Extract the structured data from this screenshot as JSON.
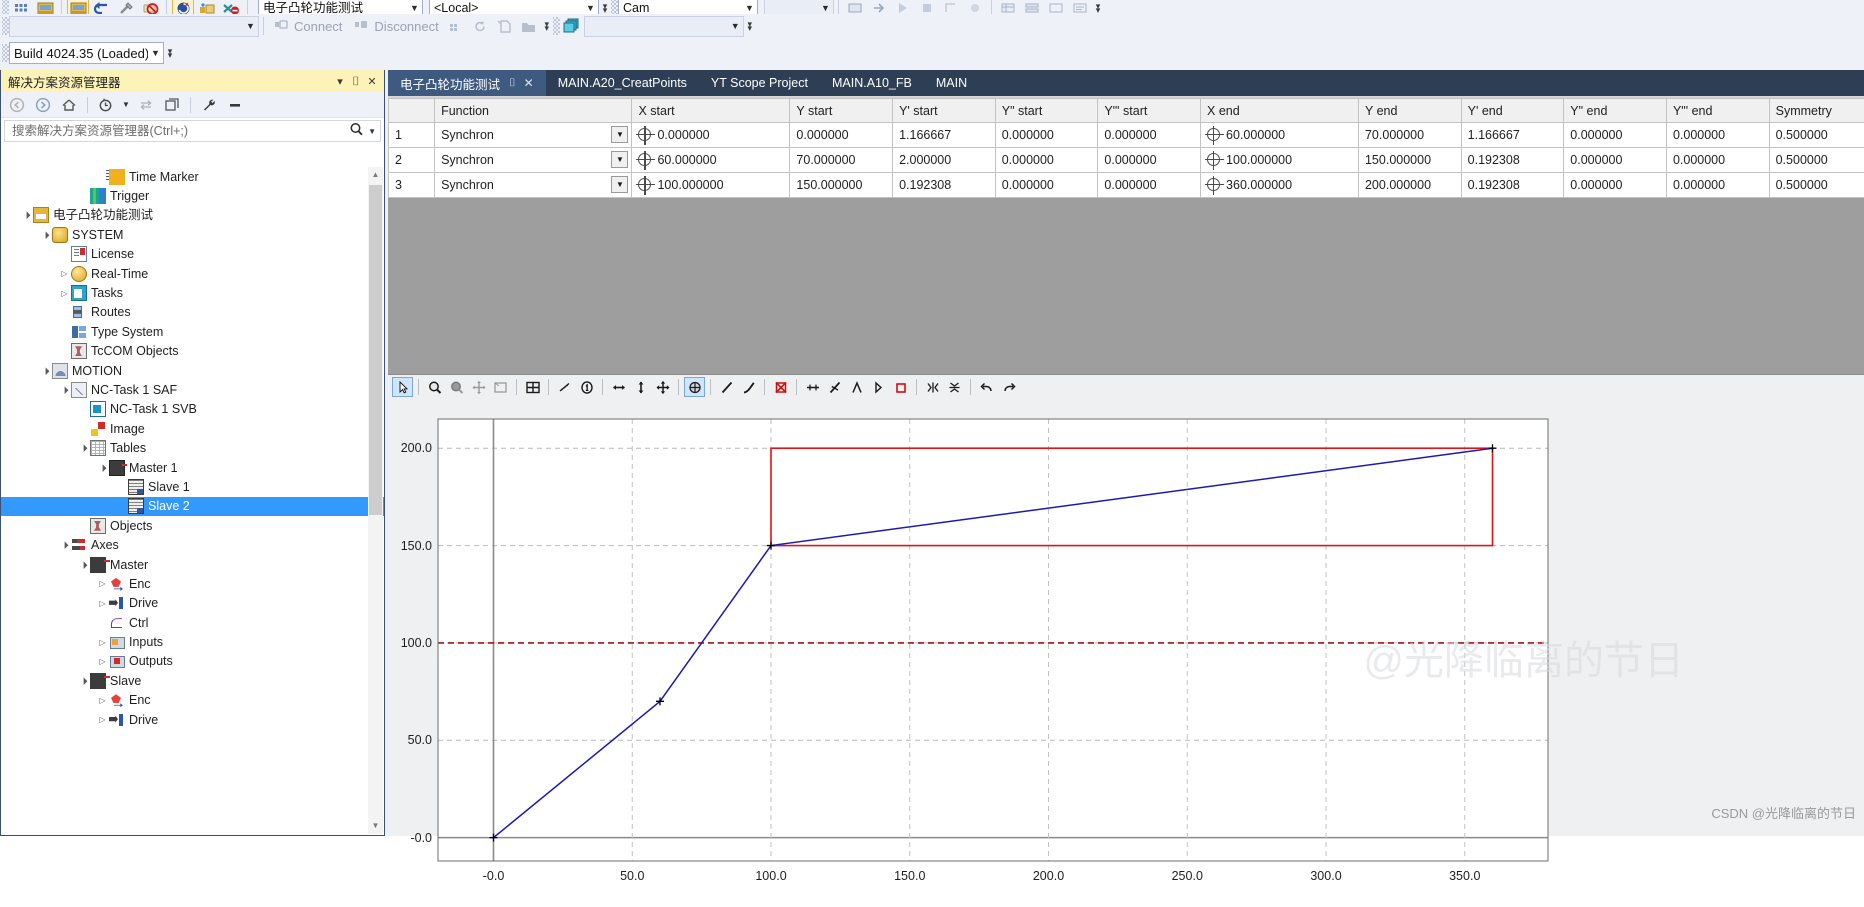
{
  "toolbar": {
    "project_combo": "电子凸轮功能测试",
    "target_combo": "<Local>",
    "cam_combo": "Cam",
    "blank_combo": "",
    "blank_combo2": "",
    "build_combo": "Build 4024.35 (Loaded)",
    "connect_label": "Connect",
    "disconnect_label": "Disconnect",
    "overflow_glyph": "▾"
  },
  "solution_explorer": {
    "title": "解决方案资源管理器",
    "title_buttons": [
      "▾",
      "⌷",
      "✕"
    ],
    "tools": [
      "back-arrow",
      "forward-arrow",
      "home",
      "history",
      "sync",
      "collapse-all",
      "properties",
      "show-all"
    ],
    "search_placeholder": "搜索解决方案资源管理器(Ctrl+;)",
    "tree": [
      {
        "label": "Time Marker",
        "indent": 5,
        "expander": "",
        "icon": "time-marker-icon",
        "selected": false
      },
      {
        "label": "Trigger",
        "indent": 4,
        "expander": "",
        "icon": "trigger-icon",
        "selected": false
      },
      {
        "label": "电子凸轮功能测试",
        "indent": 1,
        "expander": "▲",
        "icon": "project-icon",
        "selected": false
      },
      {
        "label": "SYSTEM",
        "indent": 2,
        "expander": "▲",
        "icon": "system-icon",
        "selected": false
      },
      {
        "label": "License",
        "indent": 3,
        "expander": "",
        "icon": "license-icon",
        "selected": false
      },
      {
        "label": "Real-Time",
        "indent": 3,
        "expander": "▶",
        "icon": "realtime-icon",
        "selected": false
      },
      {
        "label": "Tasks",
        "indent": 3,
        "expander": "▶",
        "icon": "tasks-icon",
        "selected": false
      },
      {
        "label": "Routes",
        "indent": 3,
        "expander": "",
        "icon": "routes-icon",
        "selected": false
      },
      {
        "label": "Type System",
        "indent": 3,
        "expander": "",
        "icon": "type-system-icon",
        "selected": false
      },
      {
        "label": "TcCOM Objects",
        "indent": 3,
        "expander": "",
        "icon": "tccom-objects-icon",
        "selected": false
      },
      {
        "label": "MOTION",
        "indent": 2,
        "expander": "▲",
        "icon": "motion-icon",
        "selected": false
      },
      {
        "label": "NC-Task 1 SAF",
        "indent": 3,
        "expander": "▲",
        "icon": "nc-task-saf-icon",
        "selected": false
      },
      {
        "label": "NC-Task 1 SVB",
        "indent": 4,
        "expander": "",
        "icon": "nc-task-svb-icon",
        "selected": false
      },
      {
        "label": "Image",
        "indent": 4,
        "expander": "",
        "icon": "image-icon",
        "selected": false
      },
      {
        "label": "Tables",
        "indent": 4,
        "expander": "▲",
        "icon": "tables-icon",
        "selected": false
      },
      {
        "label": "Master 1",
        "indent": 5,
        "expander": "▲",
        "icon": "master-table-icon",
        "selected": false
      },
      {
        "label": "Slave 1",
        "indent": 6,
        "expander": "",
        "icon": "slave-table-icon",
        "selected": false
      },
      {
        "label": "Slave 2",
        "indent": 6,
        "expander": "",
        "icon": "slave-table-icon",
        "selected": true
      },
      {
        "label": "Objects",
        "indent": 4,
        "expander": "",
        "icon": "objects-icon",
        "selected": false
      },
      {
        "label": "Axes",
        "indent": 3,
        "expander": "▲",
        "icon": "axes-icon",
        "selected": false
      },
      {
        "label": "Master",
        "indent": 4,
        "expander": "▲",
        "icon": "axis-icon",
        "selected": false
      },
      {
        "label": "Enc",
        "indent": 5,
        "expander": "▶",
        "icon": "encoder-icon",
        "selected": false
      },
      {
        "label": "Drive",
        "indent": 5,
        "expander": "▶",
        "icon": "drive-icon",
        "selected": false
      },
      {
        "label": "Ctrl",
        "indent": 5,
        "expander": "",
        "icon": "ctrl-icon",
        "selected": false
      },
      {
        "label": "Inputs",
        "indent": 5,
        "expander": "▶",
        "icon": "inputs-icon",
        "selected": false
      },
      {
        "label": "Outputs",
        "indent": 5,
        "expander": "▶",
        "icon": "outputs-icon",
        "selected": false
      },
      {
        "label": "Slave",
        "indent": 4,
        "expander": "▲",
        "icon": "axis-icon",
        "selected": false
      },
      {
        "label": "Enc",
        "indent": 5,
        "expander": "▶",
        "icon": "encoder-icon",
        "selected": false
      },
      {
        "label": "Drive",
        "indent": 5,
        "expander": "▶",
        "icon": "drive-icon",
        "selected": false
      }
    ]
  },
  "editor": {
    "tabs": [
      {
        "label": "电子凸轮功能测试",
        "active": true,
        "closable": true
      },
      {
        "label": "MAIN.A20_CreatPoints",
        "active": false,
        "closable": false
      },
      {
        "label": "YT Scope Project",
        "active": false,
        "closable": false
      },
      {
        "label": "MAIN.A10_FB",
        "active": false,
        "closable": false
      },
      {
        "label": "MAIN",
        "active": false,
        "closable": false
      }
    ],
    "table": {
      "columns": [
        "",
        "Function",
        "X start",
        "Y start",
        "Y' start",
        "Y\" start",
        "Y\"' start",
        "X end",
        "Y end",
        "Y' end",
        "Y\" end",
        "Y\"' end",
        "Symmetry"
      ],
      "rows": [
        {
          "n": "1",
          "function": "Synchron",
          "x_start": "0.000000",
          "y_start": "0.000000",
          "yp_start": "1.166667",
          "ypp_start": "0.000000",
          "yppp_start": "0.000000",
          "x_end": "60.000000",
          "y_end": "70.000000",
          "yp_end": "1.166667",
          "ypp_end": "0.000000",
          "yppp_end": "0.000000",
          "symmetry": "0.500000"
        },
        {
          "n": "2",
          "function": "Synchron",
          "x_start": "60.000000",
          "y_start": "70.000000",
          "yp_start": "2.000000",
          "ypp_start": "0.000000",
          "yppp_start": "0.000000",
          "x_end": "100.000000",
          "y_end": "150.000000",
          "yp_end": "0.192308",
          "ypp_end": "0.000000",
          "yppp_end": "0.000000",
          "symmetry": "0.500000"
        },
        {
          "n": "3",
          "function": "Synchron",
          "x_start": "100.000000",
          "y_start": "150.000000",
          "yp_start": "0.192308",
          "ypp_start": "0.000000",
          "yppp_start": "0.000000",
          "x_end": "360.000000",
          "y_end": "200.000000",
          "yp_end": "0.192308",
          "ypp_end": "0.000000",
          "yppp_end": "0.000000",
          "symmetry": "0.500000"
        }
      ]
    },
    "chart_toolbar": [
      {
        "icon": "pointer-icon",
        "active": true
      },
      {
        "sep": true
      },
      {
        "icon": "zoom-icon",
        "active": false
      },
      {
        "icon": "zoom-area-icon",
        "active": false
      },
      {
        "icon": "pan-icon",
        "active": false
      },
      {
        "icon": "fit-window-icon",
        "active": false
      },
      {
        "sep": true
      },
      {
        "icon": "grid-icon",
        "active": false
      },
      {
        "sep": true
      },
      {
        "icon": "marker-icon",
        "active": false
      },
      {
        "icon": "point-index-icon",
        "active": false
      },
      {
        "sep": true
      },
      {
        "icon": "scale-horizontal-icon",
        "active": false
      },
      {
        "icon": "scale-vertical-icon",
        "active": false
      },
      {
        "icon": "move-point-icon",
        "active": false
      },
      {
        "sep": true
      },
      {
        "icon": "edit-point-icon",
        "active": true
      },
      {
        "sep": true
      },
      {
        "icon": "line-segment-icon",
        "active": false
      },
      {
        "icon": "curve-segment-icon",
        "active": false
      },
      {
        "sep": true
      },
      {
        "icon": "delete-point-icon",
        "active": false
      },
      {
        "sep": true
      },
      {
        "icon": "insert-point-icon",
        "active": false
      },
      {
        "icon": "tangent-icon",
        "active": false
      },
      {
        "icon": "slope-icon",
        "active": false
      },
      {
        "icon": "velocity-icon",
        "active": false
      },
      {
        "icon": "boundary-icon",
        "active": false
      },
      {
        "sep": true
      },
      {
        "icon": "snap-x-icon",
        "active": false
      },
      {
        "icon": "snap-y-icon",
        "active": false
      },
      {
        "sep": true
      },
      {
        "icon": "undo-icon",
        "active": false
      },
      {
        "icon": "redo-icon",
        "active": false
      }
    ]
  },
  "chart_data": {
    "type": "line",
    "title": "",
    "xlabel": "",
    "ylabel": "",
    "xlim": [
      -20,
      380
    ],
    "ylim": [
      -12,
      215
    ],
    "grid": true,
    "legend": null,
    "xticks": [
      "-0.0",
      "50.0",
      "100.0",
      "150.0",
      "200.0",
      "250.0",
      "300.0",
      "350.0"
    ],
    "xtick_values": [
      0,
      50,
      100,
      150,
      200,
      250,
      300,
      350
    ],
    "yticks": [
      "-0.0",
      "50.0",
      "100.0",
      "150.0",
      "200.0"
    ],
    "ytick_values": [
      0,
      50,
      100,
      150,
      200
    ],
    "series": [
      {
        "name": "cam-profile",
        "color": "#1a1ab4",
        "x": [
          0,
          60,
          100,
          360
        ],
        "y": [
          0,
          70,
          150,
          200
        ],
        "markers": [
          {
            "x": 0,
            "y": 0
          },
          {
            "x": 60,
            "y": 70
          },
          {
            "x": 100,
            "y": 150
          },
          {
            "x": 360,
            "y": 200
          }
        ]
      }
    ],
    "annotations": [
      {
        "kind": "rect",
        "name": "selected-segment-box",
        "color": "#e01414",
        "x0": 100,
        "y0": 150,
        "x1": 360,
        "y1": 200
      },
      {
        "kind": "hline",
        "name": "reference-line-100",
        "color": "#a01414",
        "y": 100,
        "style": "dashed"
      }
    ]
  },
  "watermark": {
    "csdn": "CSDN @光降临离的节日",
    "big": "@光降临离的节日"
  }
}
